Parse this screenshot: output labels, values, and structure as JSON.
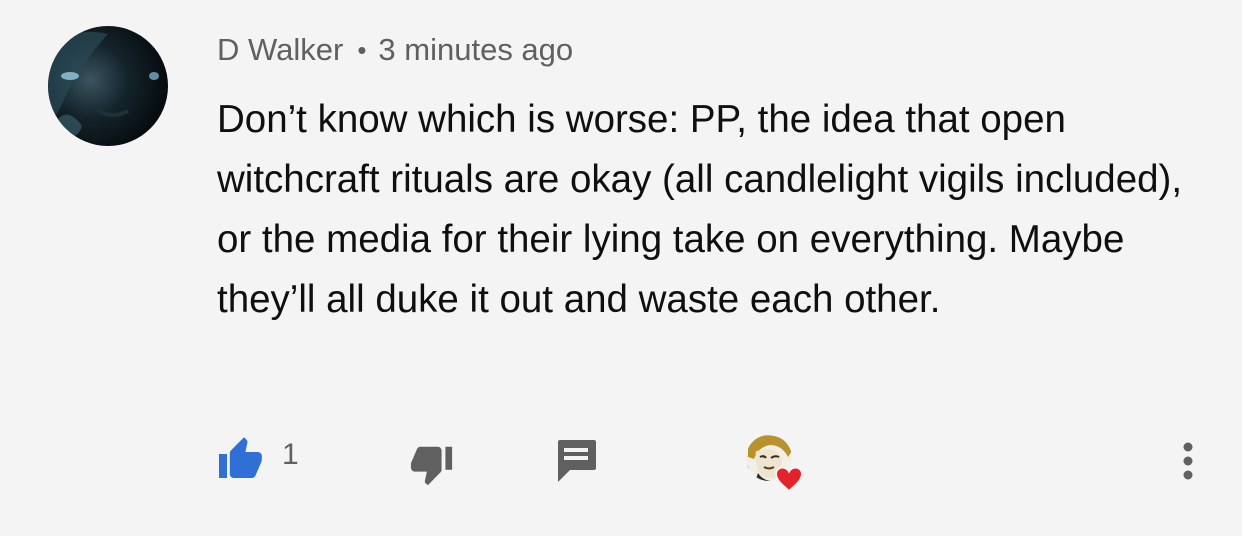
{
  "comment": {
    "author": "D Walker",
    "separator": "•",
    "timestamp": "3 minutes ago",
    "text": "Don’t know which is worse: PP, the idea that open witchcraft rituals are okay (all candlelight vigils included), or the media for their lying take on everything. Maybe they’ll all duke it out and waste each other.",
    "like_count": "1"
  },
  "actions": {
    "like_icon": "thumb-up-filled-icon",
    "dislike_icon": "thumb-down-icon",
    "reply_icon": "comment-reply-icon",
    "creator_heart_icon": "creator-heart-icon",
    "more_icon": "more-vert-icon"
  },
  "colors": {
    "background": "#f4f4f4",
    "like_active": "#2f6fd6",
    "icon_gray": "#606060",
    "heart_red": "#e3232a"
  }
}
